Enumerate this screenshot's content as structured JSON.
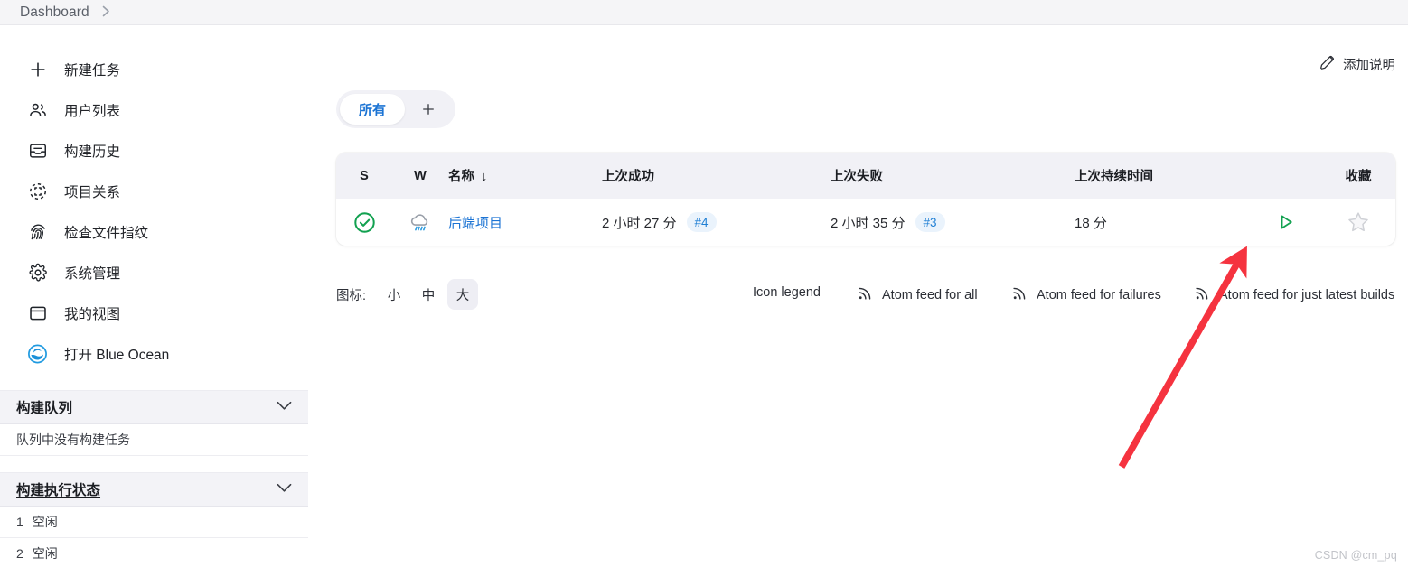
{
  "breadcrumb": {
    "items": [
      "Dashboard"
    ],
    "separator": "›"
  },
  "sidebar": {
    "items": [
      {
        "label": "新建任务",
        "icon": "plus-icon"
      },
      {
        "label": "用户列表",
        "icon": "people-icon"
      },
      {
        "label": "构建历史",
        "icon": "inbox-icon"
      },
      {
        "label": "项目关系",
        "icon": "relations-icon"
      },
      {
        "label": "检查文件指纹",
        "icon": "fingerprint-icon"
      },
      {
        "label": "系统管理",
        "icon": "gear-icon"
      },
      {
        "label": "我的视图",
        "icon": "window-icon"
      },
      {
        "label": "打开 Blue Ocean",
        "icon": "blue-ocean-icon"
      }
    ],
    "build_queue": {
      "title": "构建队列",
      "empty_text": "队列中没有构建任务",
      "chevron": "chevron-down-icon"
    },
    "build_executor": {
      "title": "构建执行状态",
      "chevron": "chevron-down-icon",
      "rows": [
        {
          "num": "1",
          "status": "空闲"
        },
        {
          "num": "2",
          "status": "空闲"
        }
      ]
    }
  },
  "main": {
    "describe_button": {
      "label": "添加说明",
      "icon": "pencil-icon"
    },
    "tabs": {
      "active": "所有",
      "add_label": "+"
    },
    "table": {
      "columns": [
        {
          "key": "s",
          "label": "S"
        },
        {
          "key": "w",
          "label": "W"
        },
        {
          "key": "name",
          "label": "名称",
          "sort": "↓"
        },
        {
          "key": "last_success",
          "label": "上次成功"
        },
        {
          "key": "last_failure",
          "label": "上次失败"
        },
        {
          "key": "last_duration",
          "label": "上次持续时间"
        },
        {
          "key": "run",
          "label": ""
        },
        {
          "key": "favorite",
          "label": "收藏"
        }
      ],
      "rows": [
        {
          "status_icon": "status-success-icon",
          "weather_icon": "weather-rain-icon",
          "name": "后端项目",
          "last_success_time": "2 小时 27 分",
          "last_success_build": "#4",
          "last_failure_time": "2 小时 35 分",
          "last_failure_build": "#3",
          "last_duration": "18 分",
          "run_icon": "play-icon",
          "favorite_icon": "star-outline-icon"
        }
      ]
    },
    "footer": {
      "icon_size_label": "图标:",
      "sizes": [
        {
          "label": "小",
          "active": false
        },
        {
          "label": "中",
          "active": false
        },
        {
          "label": "大",
          "active": true
        }
      ],
      "legend_label": "Icon legend",
      "feeds": [
        {
          "label": "Atom feed for all",
          "icon": "rss-icon"
        },
        {
          "label": "Atom feed for failures",
          "icon": "rss-icon"
        },
        {
          "label": "Atom feed for just latest builds",
          "icon": "rss-icon"
        }
      ]
    }
  },
  "annotation": {
    "arrow_color": "#f5333f",
    "name": "red-arrow-annotation"
  },
  "watermark": {
    "text": "CSDN @cm_pq"
  },
  "colors": {
    "accent_blue": "#1c74d4",
    "success_green": "#13a551",
    "badge_bg": "#eaf3fc",
    "panel_bg": "#f1f1f6",
    "breadcrumb_bg": "#f5f5f7",
    "annotation_red": "#f5333f"
  }
}
